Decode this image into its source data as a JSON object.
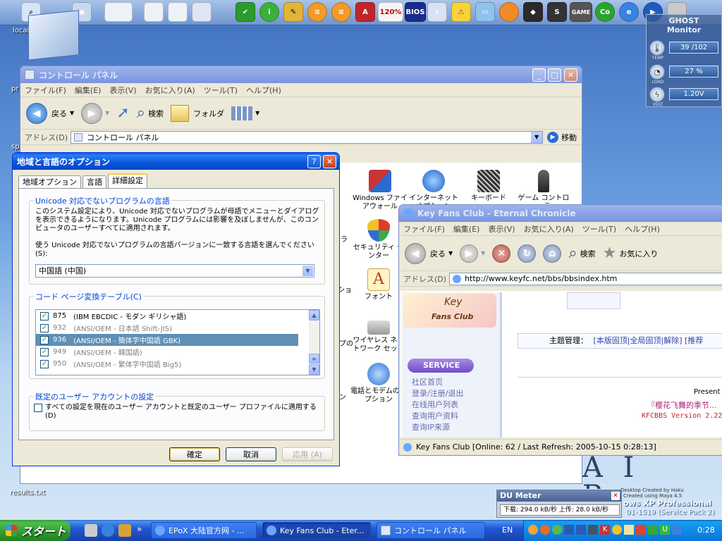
{
  "desktop": {
    "icons": [
      {
        "label": "local"
      },
      {
        "label": "pr"
      },
      {
        "label": "sp"
      },
      {
        "label": "results.txt"
      }
    ],
    "topbar_labels": {
      "percent": "120%",
      "bios": "BIOS",
      "game": "GAME"
    }
  },
  "ghost_monitor": {
    "title": "GHOST Monitor",
    "rows": [
      {
        "caption": "TEMP",
        "value": "39 /102"
      },
      {
        "caption": "LOAD",
        "value": "27 %"
      },
      {
        "caption": "VOLT",
        "value": "1.20V"
      }
    ]
  },
  "control_panel": {
    "title": "コントロール パネル",
    "menu": [
      "ファイル(F)",
      "編集(E)",
      "表示(V)",
      "お気に入り(A)",
      "ツール(T)",
      "ヘルプ(H)"
    ],
    "toolbar": {
      "back": "戻る",
      "search": "検索",
      "folders": "フォルダ"
    },
    "address_label": "アドレス(D)",
    "address_value": "コントロール パネル",
    "go_label": "移動",
    "items": [
      {
        "label": "Windows ファイアウォール"
      },
      {
        "label": "インターネット オプション"
      },
      {
        "label": "キーボード"
      },
      {
        "label": "ゲーム コントローラ"
      },
      {
        "label": "セキュリティ センター"
      },
      {
        "label": "フォント"
      },
      {
        "label": "ワイヤレス ネットワーク セット"
      },
      {
        "label": "電話とモデムのオプション"
      }
    ],
    "partial_labels": [
      "ラ",
      "ショ",
      "ップの",
      "ン"
    ]
  },
  "dialog": {
    "title": "地域と言語のオプション",
    "help": "?",
    "close": "✕",
    "tabs": [
      "地域オプション",
      "言語",
      "詳細設定"
    ],
    "unicode_group": {
      "title": "Unicode 対応でないプログラムの言語",
      "description": "このシステム設定により、Unicode 対応でないプログラムが母語でメニューとダイアログを表示できるようになります。Unicode プログラムには影響を及ぼしませんが、このコンピュータのユーザーすべてに適用されます。",
      "prompt": "使う Unicode 対応でないプログラムの言語バージョンに一致する言語を選んでください(S):",
      "selected_language": "中国語 (中国)"
    },
    "codepage_group": {
      "title": "コード ページ変換テーブル(C)",
      "rows": [
        {
          "code": "875",
          "name": "(IBM EBCDIC - モダン ギリシャ語)",
          "checked": true,
          "selected": false,
          "dim": false
        },
        {
          "code": "932",
          "name": "(ANSI/OEM - 日本語 Shift-JIS)",
          "checked": true,
          "selected": false,
          "dim": true
        },
        {
          "code": "936",
          "name": "(ANSI/OEM - 簡体字中国語 GBK)",
          "checked": true,
          "selected": true,
          "dim": false
        },
        {
          "code": "949",
          "name": "(ANSI/OEM - 韓国語)",
          "checked": true,
          "selected": false,
          "dim": true
        },
        {
          "code": "950",
          "name": "(ANSI/OEM - 繁体字中国語 Big5)",
          "checked": true,
          "selected": false,
          "dim": true
        }
      ]
    },
    "default_user_group": {
      "title": "既定のユーザー アカウントの設定",
      "checkbox_label": "すべての設定を現在のユーザー アカウントと既定のユーザー プロファイルに適用する(D)"
    },
    "buttons": {
      "ok": "確定",
      "cancel": "取消",
      "apply": "応用 (A)"
    }
  },
  "browser": {
    "title": "Key Fans Club - Eternal Chronicle",
    "menu": [
      "ファイル(F)",
      "編集(E)",
      "表示(V)",
      "お気に入り(A)",
      "ツール(T)",
      "ヘルプ(H)"
    ],
    "toolbar": {
      "back": "戻る",
      "search": "検索",
      "favorites": "お気に入り"
    },
    "address_label": "アドレス(D)",
    "url": "http://www.keyfc.net/bbs/bbsindex.htm",
    "page": {
      "logo_top": "Key",
      "logo_bottom": "Fans Club",
      "service_label": "SERVICE",
      "links": [
        "社区首页",
        "登录/注册/退出",
        "在线用户列表",
        "查询用户资料",
        "查询IP来源"
      ],
      "admin_label": "主题管理：",
      "admin_links": "[本版固顶|全局固顶|解除] [推荐",
      "present": "Present",
      "present_title": "『樱花飞舞的季节...",
      "version": "KFCBBS Version 2.22"
    },
    "status": "Key Fans Club [Online: 62 / Last Refresh: 2005-10-15 0:28:13]"
  },
  "du_meter": {
    "title": "DU Meter",
    "readout": "下载: 294.0 kB/秒  上传: 28.0 kB/秒"
  },
  "wallpaper_text": {
    "credit1": "Desktop Created by Haku",
    "credit2": "Created using Maya 4.5",
    "os": "ows XP Professional",
    "build": "01-1519 (Service Pack 2)",
    "air": "A I R"
  },
  "taskbar": {
    "start": "スタート",
    "more": "»",
    "tasks": [
      {
        "label": "EPoX 大陆官方网 - ..."
      },
      {
        "label": "Key Fans Club - Eter..."
      },
      {
        "label": "コントロール パネル"
      }
    ],
    "lang": "EN",
    "clock": "0:28"
  }
}
